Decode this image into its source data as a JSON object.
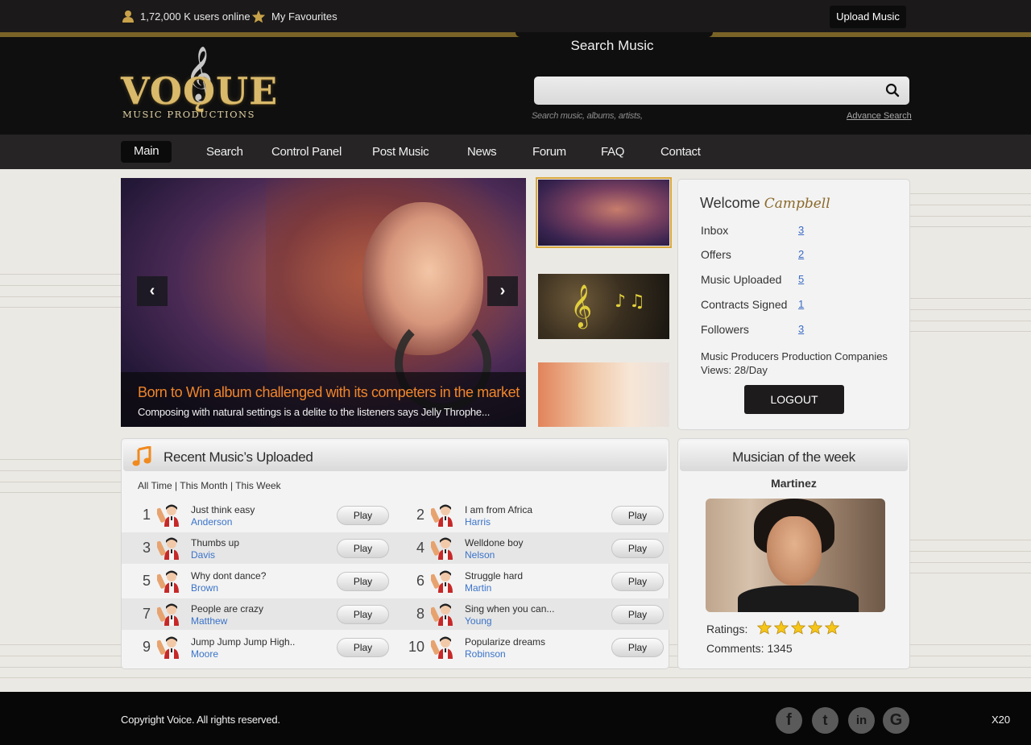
{
  "topbar": {
    "users_online": "1,72,000 K users online",
    "favourites": "My Favourites",
    "upload": "Upload Music"
  },
  "header": {
    "search_label": "Search Music",
    "search_placeholder": "",
    "search_hint": "Search music, albums, artists,",
    "advance_search": "Advance Search",
    "logo_word": "VOǪUE",
    "logo_sub": "MUSIC PRODUCTIONS"
  },
  "nav": [
    "Main",
    "Search",
    "Control Panel",
    "Post Music",
    "News",
    "Forum",
    "FAQ",
    "Contact"
  ],
  "slider": {
    "title": "Born to Win album challenged with its competers in the market",
    "subtitle": "Composing with natural settings is a delite to the listeners says Jelly Throphe...",
    "prev": "‹",
    "next": "›"
  },
  "welcome": {
    "greeting": "Welcome",
    "username": "Campbell",
    "stats": [
      {
        "label": "Inbox",
        "value": "3"
      },
      {
        "label": "Offers",
        "value": "2"
      },
      {
        "label": "Music Uploaded",
        "value": "5"
      },
      {
        "label": "Contracts Signed",
        "value": "1"
      },
      {
        "label": "Followers",
        "value": "3"
      }
    ],
    "views_line1": "Music Producers Production Companies",
    "views_line2": "Views: 28/Day",
    "logout": "LOGOUT"
  },
  "recent": {
    "title": "Recent Music’s Uploaded",
    "filters": [
      "All Time",
      "This Month",
      "This Week"
    ],
    "play_label": "Play",
    "tracks": [
      {
        "num": "1",
        "title": "Just think easy",
        "artist": "Anderson"
      },
      {
        "num": "2",
        "title": "I am from Africa",
        "artist": "Harris"
      },
      {
        "num": "3",
        "title": "Thumbs up",
        "artist": "Davis"
      },
      {
        "num": "4",
        "title": "Welldone boy",
        "artist": "Nelson"
      },
      {
        "num": "5",
        "title": "Why dont dance?",
        "artist": "Brown"
      },
      {
        "num": "6",
        "title": "Struggle hard",
        "artist": "Martin"
      },
      {
        "num": "7",
        "title": "People are crazy",
        "artist": "Matthew"
      },
      {
        "num": "8",
        "title": "Sing when you can...",
        "artist": "Young"
      },
      {
        "num": "9",
        "title": "Jump Jump Jump High..",
        "artist": "Moore"
      },
      {
        "num": "10",
        "title": "Popularize dreams",
        "artist": "Robinson"
      }
    ]
  },
  "musician": {
    "title": "Musician of the week",
    "name": "Martinez",
    "ratings_label": "Ratings:",
    "rating": 5,
    "rating_max": 5,
    "comments_label": "Comments:",
    "comments": "1345"
  },
  "footer": {
    "copyright": "Copyright Voice. All rights reserved.",
    "social": [
      {
        "name": "facebook-icon",
        "glyph": "f"
      },
      {
        "name": "twitter-icon",
        "glyph": "t"
      },
      {
        "name": "linkedin-icon",
        "glyph": "in"
      },
      {
        "name": "google-icon",
        "glyph": "G"
      }
    ],
    "badge": "X20"
  },
  "colors": {
    "accent_gold": "#d9a93c",
    "caption_orange": "#f0852a",
    "link_blue": "#3a73c9"
  }
}
